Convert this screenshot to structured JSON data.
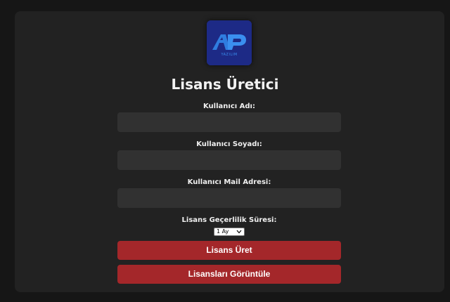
{
  "logo": {
    "letters": "AP",
    "subtext": "YAZILIM",
    "icon": "ap-logo-icon"
  },
  "title": "Lisans Üretici",
  "form": {
    "first_name_label": "Kullanıcı Adı:",
    "first_name_value": "",
    "last_name_label": "Kullanıcı Soyadı:",
    "last_name_value": "",
    "email_label": "Kullanıcı Mail Adresi:",
    "email_value": "",
    "validity_label": "Lisans Geçerlilik Süresi:",
    "validity_selected": "1 Ay"
  },
  "buttons": {
    "generate": "Lisans Üret",
    "view": "Lisansları Görüntüle"
  },
  "colors": {
    "background": "#161616",
    "panel": "#222222",
    "input": "#313131",
    "button": "#a4272a",
    "logo_bg": "#1d2a86"
  }
}
